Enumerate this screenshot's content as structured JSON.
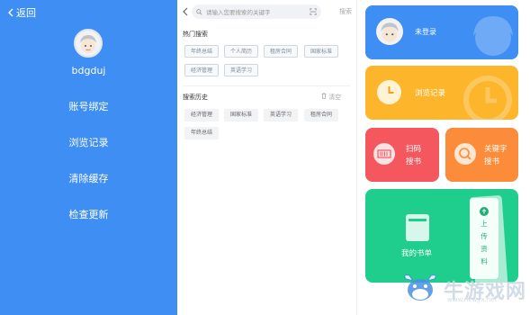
{
  "left": {
    "back_label": "返回",
    "username": "bdgduj",
    "menu": [
      "账号绑定",
      "浏览记录",
      "清除缓存",
      "检查更新"
    ]
  },
  "search": {
    "placeholder": "请输入您要搜索的关键字",
    "button": "搜索",
    "hot_title": "热门搜索",
    "hot_tags": [
      "年终总结",
      "个人简历",
      "租房合同",
      "国家标准",
      "经济管理",
      "英语学习"
    ],
    "history_title": "搜索历史",
    "clear_label": "清空",
    "history_tags": [
      "经济管理",
      "国家标准",
      "英语学习",
      "租房合同",
      "年终总结"
    ]
  },
  "cards": {
    "login": "未登录",
    "history": "浏览记录",
    "scan_line1": "扫码",
    "scan_line2": "搜书",
    "keyword_line1": "关键字",
    "keyword_line2": "搜书",
    "bookshelf": "我的书单",
    "upload_chars": [
      "上",
      "传",
      "资",
      "料"
    ]
  },
  "colors": {
    "left_bg": "#3f8ef4",
    "login_card": "#3f8ef4",
    "history_card": "#fdb52b",
    "scan_card": "#f5575f",
    "keyword_card": "#fc8c3a",
    "bookshelf_card": "#1fce8d"
  },
  "watermark": {
    "text": "牛游戏网",
    "url": "www.newyx.net"
  }
}
